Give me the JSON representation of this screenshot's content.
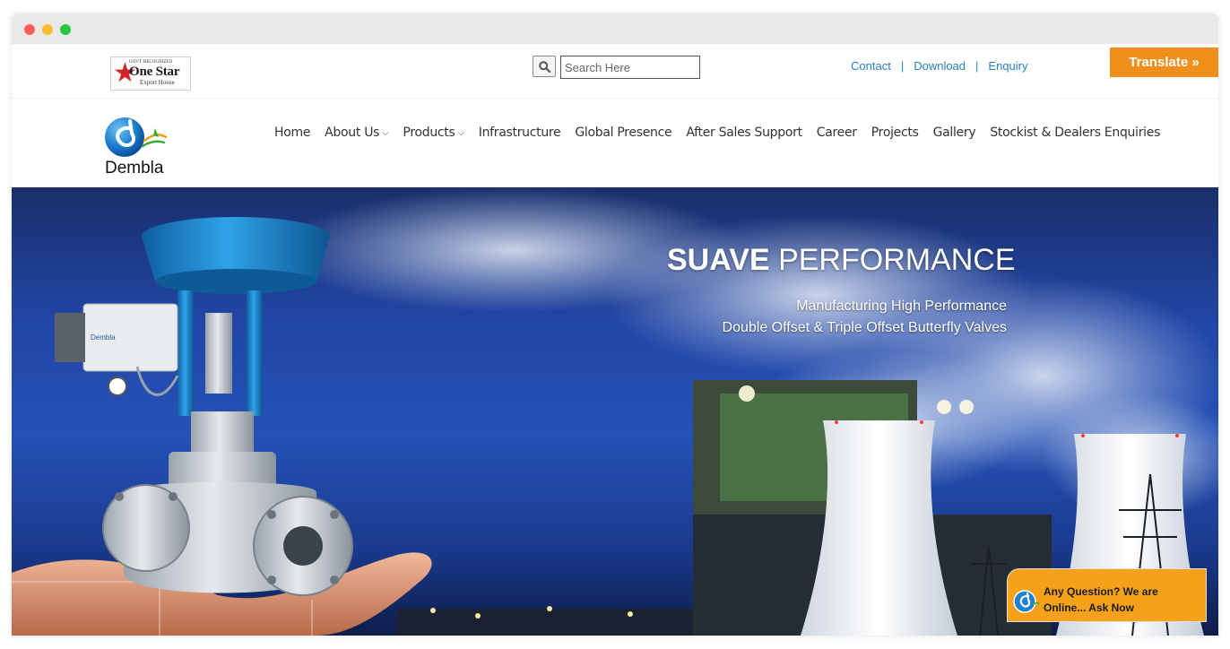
{
  "window": {
    "controls": [
      "close",
      "minimize",
      "maximize"
    ]
  },
  "topbar": {
    "partner_logo": {
      "tiny": "GOVT. RECOGNIZED",
      "name": "One Star",
      "sub": "Export House"
    },
    "search": {
      "placeholder": "Search Here",
      "icon": "search-icon"
    },
    "links": [
      {
        "label": "Contact"
      },
      {
        "label": "Download"
      },
      {
        "label": "Enquiry"
      }
    ],
    "separator": "|",
    "translate_label": "Translate »"
  },
  "navbar": {
    "logo_text": "Dembla",
    "items": [
      {
        "label": "Home",
        "dropdown": false
      },
      {
        "label": "About Us",
        "dropdown": true
      },
      {
        "label": "Products",
        "dropdown": true
      },
      {
        "label": "Infrastructure",
        "dropdown": false
      },
      {
        "label": "Global Presence",
        "dropdown": false
      },
      {
        "label": "After Sales Support",
        "dropdown": false
      },
      {
        "label": "Career",
        "dropdown": false
      },
      {
        "label": "Projects",
        "dropdown": false
      },
      {
        "label": "Gallery",
        "dropdown": false
      },
      {
        "label": "Stockist & Dealers Enquiries",
        "dropdown": false
      }
    ]
  },
  "hero": {
    "title_bold": "SUAVE",
    "title_rest": "PERFORMANCE",
    "subtitle_line1": "Manufacturing High Performance",
    "subtitle_line2": "Double Offset & Triple Offset Butterfly Valves",
    "valve_brand_text": "Dembla"
  },
  "chat": {
    "line1": "Any Question? We are",
    "line2": "Online... Ask Now"
  },
  "colors": {
    "link": "#2a7fc1",
    "accent": "#f18f1c",
    "chat_bg": "#f5a21a",
    "hero_sky": "#2146a6",
    "valve_blue": "#1d8fd8"
  }
}
